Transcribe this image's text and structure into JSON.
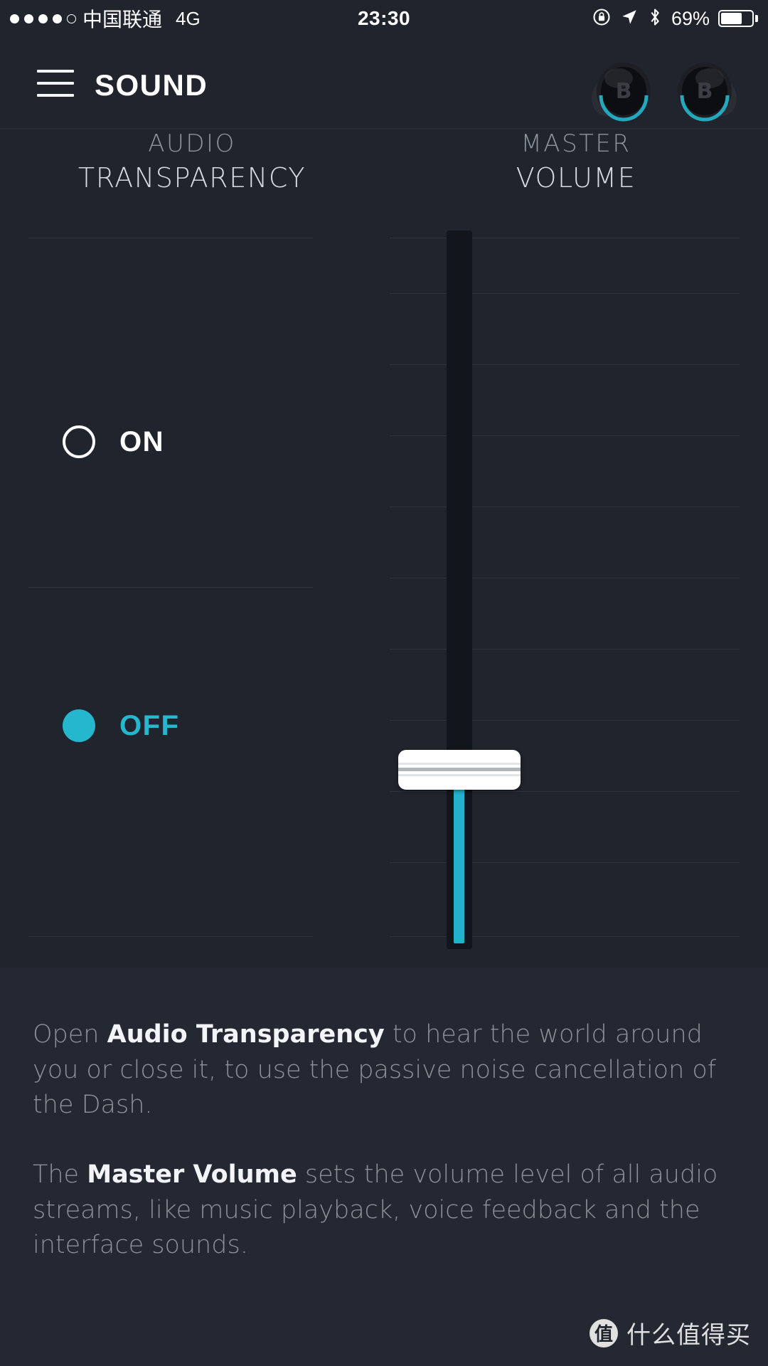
{
  "status_bar": {
    "signal_dots_filled": 4,
    "signal_dots_total": 5,
    "carrier": "中国联通",
    "network": "4G",
    "time": "23:30",
    "battery_percent": "69%",
    "battery_level": 69,
    "icons": [
      "rotation-lock-icon",
      "location-arrow-icon",
      "bluetooth-icon"
    ]
  },
  "header": {
    "menu_icon": "hamburger-menu-icon",
    "title": "SOUND",
    "device_icon_left": "earbud-left-icon",
    "device_icon_right": "earbud-right-icon"
  },
  "columns": {
    "transparency": {
      "title_line1": "AUDIO",
      "title_line2": "TRANSPARENCY",
      "options": [
        {
          "label": "ON",
          "selected": false
        },
        {
          "label": "OFF",
          "selected": true
        }
      ]
    },
    "volume": {
      "title_line1": "MASTER",
      "title_line2": "VOLUME",
      "value_percent": 25,
      "slider_name": "master-volume-slider"
    }
  },
  "description": {
    "paragraph1": {
      "before": "Open ",
      "bold": "Audio Transparency",
      "after": " to hear the world around you or close it, to use the passive noise cancellation of the Dash."
    },
    "paragraph2": {
      "before": "The ",
      "bold": "Master Volume",
      "after": " sets the volume level of all audio streams, like music playback, voice feedback and the interface sounds."
    }
  },
  "watermark": {
    "logo_glyph": "值",
    "text": "什么值得买"
  },
  "colors": {
    "background": "#20242d",
    "panel": "#242832",
    "accent": "#25b7ce",
    "text_primary": "#ffffff",
    "text_muted": "#8b9199",
    "grid_line": "#2f343d",
    "track": "#12151c"
  }
}
